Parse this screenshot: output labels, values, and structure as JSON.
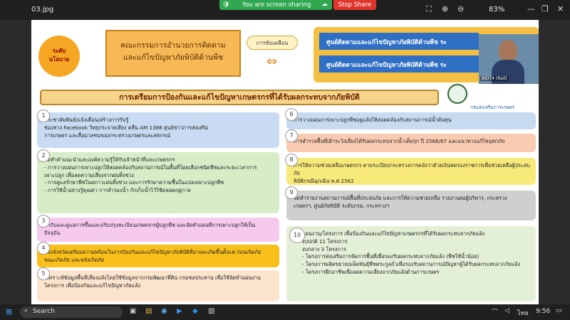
{
  "window": {
    "file_name": "03.jpg",
    "zoom": "83%"
  },
  "share_bar": {
    "sharing": "You are screen sharing",
    "stop": "Stop Share"
  },
  "header": {
    "level_label": "ระดับ\nนโยบาย",
    "committee": "คณะกรรมการอำนวยการติดตาม\nและแก้ไขปัญหาภัยพิบัติด้านพืช",
    "drive": "การขับเคลื่อน",
    "center_1": "ศูนย์ติดตามและแก้ไขปัญหาภัยพิบัติด้านพืช ระ",
    "center_2": "ศูนย์ติดตามและแก้ไขปัญหาภัยพิบัติด้านพืช ระ"
  },
  "main_title": "การเตรียมการป้องกันและแก้ไขปัญหาเกษตรกรที่ได้รับผลกระทบจากภัยพิบัติ",
  "dept": "กรมส่งเสริมการเกษตร",
  "video": {
    "name": "BIDT4 (Rall)"
  },
  "left_items": [
    {
      "n": "1",
      "text": "ประชาสัมพันธ์/แจ้งเตือน/สร้างการรับรู้\n   ช่องทาง Facebook วิทยุกระจายเสียง คลื่น AM 1386 ศูนย์ข่าวการส่งเสริม\nการเกษตร และสื่อมวลชนของกระทรวงเกษตรและสหกรณ์"
    },
    {
      "n": "2",
      "text": "จัดทำคำแนะนำและองค์ความรู้ให้กับเจ้าหน้าที่และเกษตรกร\n - การวางแผนการเพาะปลูกให้สอดคล้องกับสถานการณ์ในพื้นที่โดยเลือกชนิดพืชและระยะเวลาการ\n   เพาะปลูก เพื่อลดความเสี่ยงจากฝนทิ้งช่วง\n - การดูแลรักษาพืชในสภาวะฝนทิ้งช่วง และการรักษาความชื้นในแปลงเพาะปลูกพืช\n - การใช้น้ำอย่างรู้คุณค่า การสำรองน้ำ กักเก็บน้ำไว้ใช้ตลอดฤดูกาล"
    },
    {
      "n": "3",
      "text": "กำกับและดูแลการขึ้นและปรับปรุงทะเบียนเกษตรกรผู้ปลูกพืช และจัดทำแผนที่การเพาะปลูกให้เป็น\nปัจจุบัน"
    },
    {
      "n": "4",
      "text": "แจ้งจังหวัดเตรียมความพร้อมในการป้องกันและแก้ไขปัญหาภัยพิบัติที่อาจจะเกิดขึ้นตั้งแต่ ก่อนเกิดภัย\nขณะเกิดภัย และหลังเกิดภัย"
    },
    {
      "n": "5",
      "text": "วิเคราะห์ข้อมูลพื้นที่เสี่ยงแล้งโดยใช้ข้อมูลจากกรมพัฒนาที่ดิน กรมชลประทาน เพื่อใช้จัดทำแผนงาน\nโครงการ เพื่อป้องกันและแก้ไขปัญหาภัยแล้ง"
    }
  ],
  "right_items": [
    {
      "n": "6",
      "text": "การวางแผนการเพาะปลูกพืชฤดูแล้งให้สอดคล้องกับสถานการณ์น้ำต้นทุน"
    },
    {
      "n": "7",
      "text": "การสำรวจพื้นที่เฝ้าระวังเสี่ยงได้รับผลกระทบจากน้ำเค็มรุก ปี 2566/67 และแนวทางแก้ไขอุทกภัย"
    },
    {
      "n": "8",
      "text": "การให้ความช่วยเหลือเกษตรกร ตามระเบียบกระทรวงการคลังว่าด้วยเงินทดรองราชการเพื่อช่วยเหลือผู้ประสบภัย\nพิบัติกรณีฉุกเฉิน พ.ศ.2562"
    },
    {
      "n": "9",
      "text": "จัดทำรายงานสถานการณ์พื้นที่ประสบภัย และการให้ความช่วยเหลือ รายงานต่อผู้บริหาร, กระทรวง\nเกษตรฯ, ศูนย์ภัยพิบัติ ระดับกรม, กระทรวงฯ"
    },
    {
      "n": "10",
      "text": "แผนงาน/โครงการ เพื่อป้องกันและแก้ไขปัญหาเกษตรกรที่ได้รับผลกระทบจากภัยแล้ง\nงบปกติ 11 โครงการ\nงบกลาง 3 โครงการ\n - โครงการส่งเสริมการจัดการพื้นที่เพื่อรองรับผลกระทบจากภัยแล้ง (พืชใช้น้ำน้อย)\n - โครงการผลิตขยายเมล็ดพันธุ์พืชตระกูลถั่วเพื่อรองรับสถานการณ์ปัญหาผู้ได้รับผลกระทบจากภัยแล้ง\n - โครงการฝึกอาชีพเพื่อลดความเสี่ยงจากภัยแล้งด้านการเกษตร"
    }
  ],
  "taskbar": {
    "search": "Search",
    "lang": "ไทย",
    "time": "9:56"
  }
}
